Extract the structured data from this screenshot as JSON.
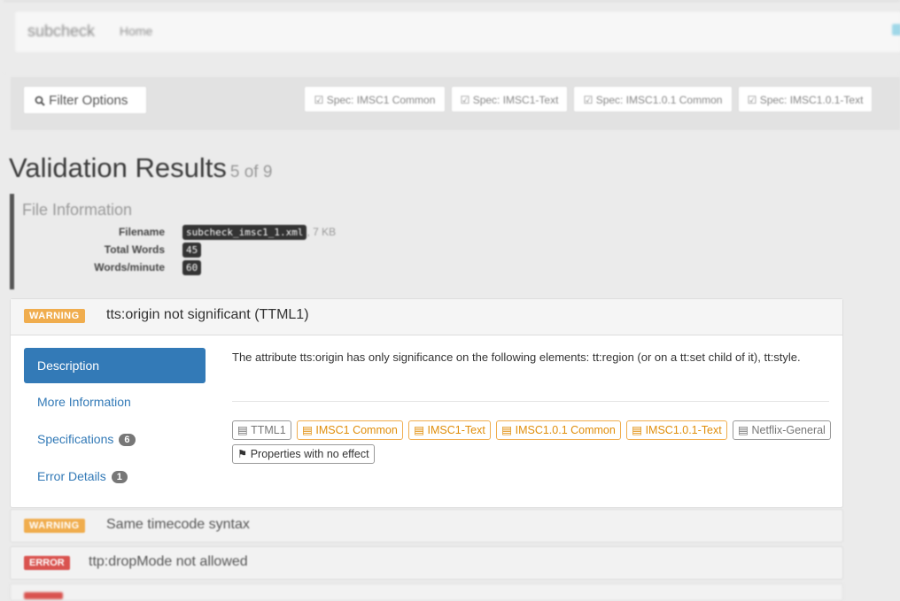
{
  "navbar": {
    "brand": "subcheck",
    "home": "Home"
  },
  "filter": {
    "button": "Filter Options",
    "specs": [
      "Spec: IMSC1 Common",
      "Spec: IMSC1-Text",
      "Spec: IMSC1.0.1 Common",
      "Spec: IMSC1.0.1-Text"
    ]
  },
  "results": {
    "title": "Validation Results",
    "count": "5 of 9"
  },
  "file_info": {
    "heading": "File Information",
    "filename_label": "Filename",
    "filename": "subcheck_imsc1_1.xml",
    "size": ", 7 KB",
    "total_words_label": "Total Words",
    "total_words": "45",
    "wpm_label": "Words/minute",
    "wpm": "60"
  },
  "issue": {
    "level": "WARNING",
    "title": "tts:origin not significant (TTML1)",
    "menu": {
      "description": "Description",
      "more_info": "More Information",
      "specifications": "Specifications",
      "specifications_count": "6",
      "error_details": "Error Details",
      "error_details_count": "1"
    },
    "description": "The attribute tts:origin has only significance on the following elements: tt:region (or on a tt:set child of it), tt:style.",
    "tags": [
      {
        "text": "TTML1",
        "style": "gray"
      },
      {
        "text": "IMSC1 Common",
        "style": "orange"
      },
      {
        "text": "IMSC1-Text",
        "style": "orange"
      },
      {
        "text": "IMSC1.0.1 Common",
        "style": "orange"
      },
      {
        "text": "IMSC1.0.1-Text",
        "style": "orange"
      },
      {
        "text": "Netflix-General",
        "style": "gray"
      },
      {
        "text": "Properties with no effect",
        "style": "dark"
      }
    ]
  },
  "collapsed": [
    {
      "level": "WARNING",
      "title": "Same timecode syntax"
    },
    {
      "level": "ERROR",
      "title": "ttp:dropMode not allowed"
    }
  ]
}
